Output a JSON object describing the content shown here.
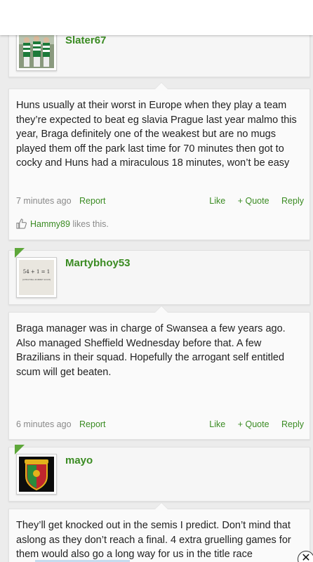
{
  "posts": [
    {
      "username": "Slater67",
      "message": "",
      "time": "",
      "report": "",
      "like": "",
      "quote": "",
      "reply": "",
      "liker": "",
      "likes_suffix": ""
    },
    {
      "username": "",
      "message": "Huns usually at their worst in Europe when they play a team they’re expected to beat eg slavia Prague last year malmo this year, Braga definitely one of the weakest but are no mugs played them off the park last time for 70 minutes then got to cocky and Huns had a miraculous 18 minutes, won’t be easy",
      "time": "7 minutes ago",
      "report": "Report",
      "like": "Like",
      "quote": "+ Quote",
      "reply": "Reply",
      "liker": "Hammy89",
      "likes_suffix": " likes this."
    },
    {
      "username": "Martybhoy53",
      "avatar_text": "54 + 1 = 1",
      "avatar_subtext": "[CHEATING ZOMBIE SCUM]",
      "message": "Braga manager was in charge of Swansea a few years ago. Also managed Sheffield Wednesday before that. A few Brazilians in their squad. Hopefully the arrogant self entitled scum will get beaten.",
      "time": "6 minutes ago",
      "report": "Report",
      "like": "Like",
      "quote": "+ Quote",
      "reply": "Reply"
    },
    {
      "username": "mayo",
      "message": "They’ll get knocked out in the semis I predict. Don’t mind that aslong as they don’t reach a final. 4 extra gruelling games for them would also go a long way for us in the title race"
    }
  ],
  "colors": {
    "accent": "#3a8b22",
    "corner": "#5ea73a",
    "muted": "#8a8a8a"
  },
  "icons": {
    "like": "thumbs-up-icon",
    "close": "close-icon"
  },
  "close_glyph": "✕"
}
